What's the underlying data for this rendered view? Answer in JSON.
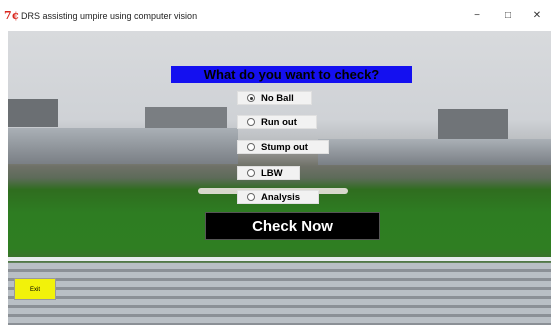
{
  "window": {
    "icon": "feather-logo-icon",
    "icon_glyph": "7¢",
    "title": "DRS assisting umpire using computer vision",
    "minimize": "−",
    "maximize": "□",
    "close": "✕"
  },
  "form": {
    "heading": "What do you want to check?",
    "options": [
      {
        "label": "No Ball",
        "selected": true
      },
      {
        "label": "Run out",
        "selected": false
      },
      {
        "label": "Stump out",
        "selected": false
      },
      {
        "label": "LBW",
        "selected": false
      },
      {
        "label": "Analysis",
        "selected": false
      }
    ],
    "check_button": "Check Now",
    "exit_button": "Exit"
  },
  "colors": {
    "heading_bg": "#1410f0",
    "check_bg": "#000000",
    "exit_bg": "#f2f20a"
  }
}
